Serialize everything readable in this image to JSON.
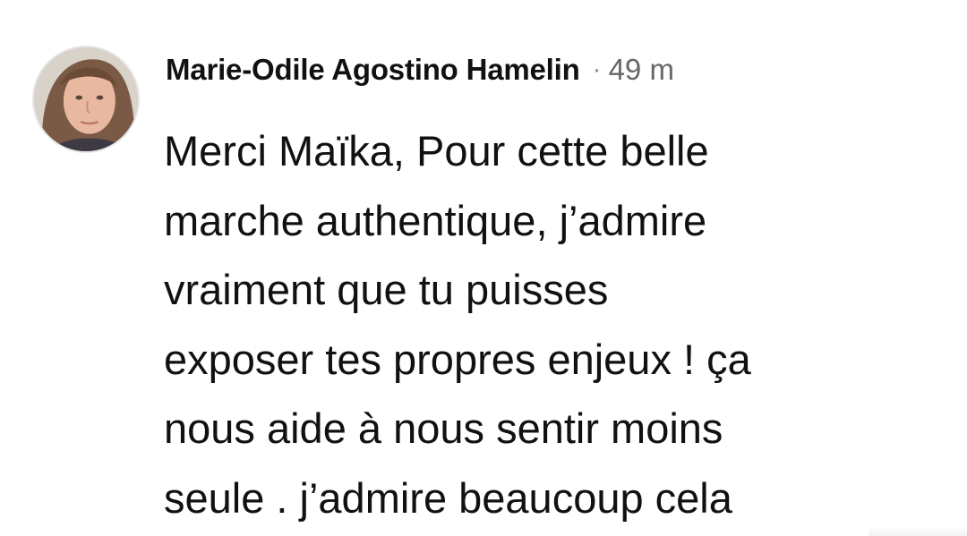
{
  "comment": {
    "author": "Marie-Odile Agostino Hamelin",
    "separator": "·",
    "timestamp": "49 m",
    "lines": [
      "Merci  Maïka, Pour cette belle",
      "marche authentique, j’admire",
      "vraiment que tu puisses",
      "exposer tes propres enjeux ! ça",
      "nous aide à nous sentir moins",
      "seule . j’admire beaucoup cela"
    ]
  },
  "colors": {
    "text": "#111111",
    "meta": "#65676b",
    "background": "#ffffff"
  },
  "icons": {
    "avatar": "profile-photo"
  }
}
